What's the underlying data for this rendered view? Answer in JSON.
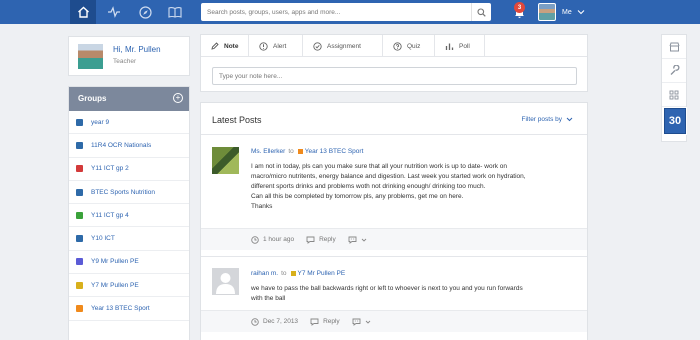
{
  "topbar": {
    "search_placeholder": "Search posts, groups, users, apps and more...",
    "notification_count": "3",
    "user_label": "Me"
  },
  "profile": {
    "greeting": "Hi, Mr. Pullen",
    "role": "Teacher"
  },
  "groups": {
    "title": "Groups",
    "items": [
      {
        "label": "year 9",
        "color": "#2e6aa8"
      },
      {
        "label": "11R4 OCR Nationals",
        "color": "#2e6aa8"
      },
      {
        "label": "Y11 ICT gp 2",
        "color": "#d33a3a"
      },
      {
        "label": "BTEC Sports Nutrition",
        "color": "#2e6aa8"
      },
      {
        "label": "Y11 ICT gp 4",
        "color": "#3aa23a"
      },
      {
        "label": "Y10 ICT",
        "color": "#2e6aa8"
      },
      {
        "label": "Y9 Mr Pullen PE",
        "color": "#5b5bd6"
      },
      {
        "label": "Y7 Mr Pullen PE",
        "color": "#d8b01c"
      },
      {
        "label": "Year 13 BTEC Sport",
        "color": "#f08a1c"
      }
    ]
  },
  "composer": {
    "tabs": [
      {
        "label": "Note",
        "icon": "pencil-icon"
      },
      {
        "label": "Alert",
        "icon": "alert-icon"
      },
      {
        "label": "Assignment",
        "icon": "check-circle-icon"
      },
      {
        "label": "Quiz",
        "icon": "question-icon"
      },
      {
        "label": "Poll",
        "icon": "bar-chart-icon"
      }
    ],
    "note_placeholder": "Type your note here..."
  },
  "posts": {
    "title": "Latest Posts",
    "filter_label": "Filter posts by",
    "items": [
      {
        "author": "Ms. Ellerker",
        "to": "to",
        "group": "Year 13 BTEC Sport",
        "group_color": "#f08a1c",
        "body_lines": [
          "I am not in today, pls can you make sure that all your nutrition work is up to date- work on",
          "macro/micro nutritents, energy balance and digestion. Last week you started work on hydration,",
          "different sports drinks and problems woth not drinking enough/ drinking too much.",
          "Can all this be completed by tomorrow pls, any problems, get me on here.",
          "Thanks"
        ],
        "time": "1 hour ago",
        "reply": "Reply"
      },
      {
        "author": "raihan m.",
        "to": "to",
        "group": "Y7 Mr Pullen PE",
        "group_color": "#d8b01c",
        "body_lines": [
          "we have to pass the ball backwards right or left to whoever is next to you and you run forwards",
          "with the ball"
        ],
        "time": "Dec 7, 2013",
        "reply": "Reply"
      }
    ]
  },
  "calendar": {
    "day": "30"
  }
}
